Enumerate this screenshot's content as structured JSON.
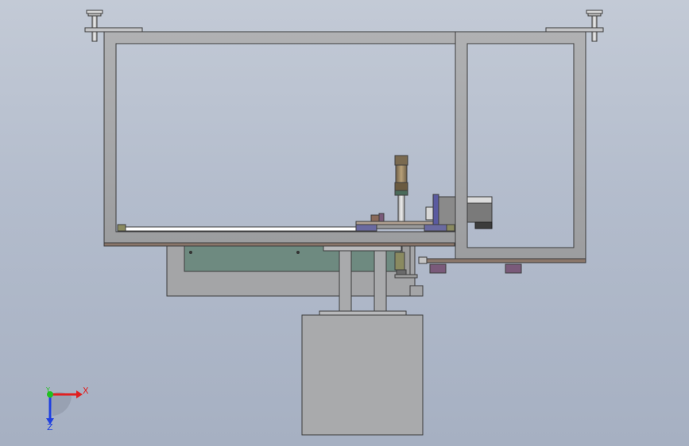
{
  "viewport": {
    "background_top": "#c3cad6",
    "background_bottom": "#a6b0c2"
  },
  "colors": {
    "frame_fill": "#a9aaac",
    "frame_edge": "#3c3c3c",
    "plate_brown": "#7a6a60",
    "panel_green": "#6e8a80",
    "motor_dark": "#5a5a5a",
    "cylinder_brown": "#8a7a60",
    "block_purple": "#7a5a7a",
    "block_blue": "#5a5aa0",
    "axis_x": "#e02020",
    "axis_y": "#20c020",
    "axis_z": "#2040e0"
  },
  "triad": {
    "x_label": "X",
    "y_label": "Y",
    "z_label": "Z"
  }
}
